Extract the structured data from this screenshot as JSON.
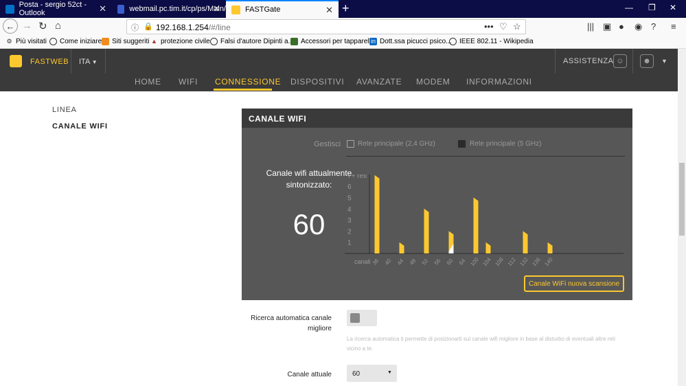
{
  "browser": {
    "tabs": [
      {
        "title": "Posta - sergio 52ct - Outlook",
        "active": false,
        "icon": "outlook-icon"
      },
      {
        "title": "webmail.pc.tim.it/cp/ps/Main/",
        "active": false,
        "icon": "mail-icon"
      },
      {
        "title": "FASTGate",
        "active": true,
        "icon": "fastweb-icon"
      }
    ],
    "url_host": "192.168.1.254",
    "url_path": "/#/line",
    "url_actions": "•••",
    "bookmarks": [
      "Più visitati",
      "Come iniziare",
      "Siti suggeriti",
      "protezione civile",
      "Falsi d'autore Dipinti a...",
      "Accessori per tapparelle",
      "Dott.ssa picucci psico...",
      "IEEE 802.11 - Wikipedia"
    ]
  },
  "header": {
    "brand": "FASTWEB",
    "lang": "ITA",
    "assist": "ASSISTENZA",
    "nav": [
      "HOME",
      "WIFI",
      "CONNESSIONE",
      "DISPOSITIVI",
      "AVANZATE",
      "MODEM",
      "INFORMAZIONI"
    ],
    "nav_active": "CONNESSIONE",
    "accent": "#fdc82f"
  },
  "sidebar": {
    "items": [
      "LINEA",
      "CANALE WIFI"
    ],
    "selected": "CANALE WIFI"
  },
  "panel": {
    "title": "CANALE WIFI",
    "gestisci": "Gestisci",
    "opt1": "Rete principale (2,4 GHz)",
    "opt2": "Rete principale (5 GHz)",
    "channel_label": "Canale wifi attualmente sintonizzato:",
    "channel_value": "60",
    "scan_button": "Canale WiFi nuova scansione"
  },
  "chart_data": {
    "type": "bar",
    "xlabel": "canali",
    "categories": [
      "36",
      "40",
      "44",
      "48",
      "52",
      "56",
      "60",
      "64",
      "100",
      "104",
      "108",
      "112",
      "132",
      "136",
      "140"
    ],
    "values": [
      7,
      0,
      1,
      0,
      4,
      0,
      2,
      0,
      5,
      1,
      0,
      0,
      2,
      0,
      1
    ],
    "highlight": "60",
    "yticks": [
      "1",
      "2",
      "3",
      "4",
      "5",
      "6",
      "7+ reti"
    ],
    "ylim": [
      0,
      7
    ],
    "bar_color": "#fdc82f",
    "highlight_color": "#ffffff"
  },
  "form": {
    "auto_label": "Ricerca automatica canale migliore",
    "auto_help": "La ricerca automatica ti permette di posizionarti sul canale wifi migliore in base al disturbo di eventuali altre reti vicino a te.",
    "auto_enabled": false,
    "current_label": "Canale attuale",
    "current_value": "60"
  }
}
